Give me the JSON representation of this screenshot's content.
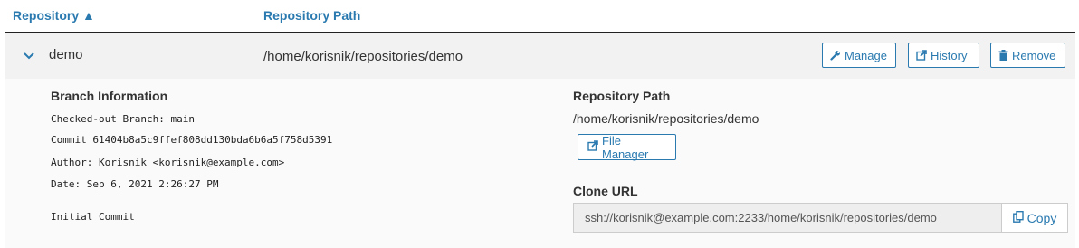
{
  "table": {
    "columns": [
      {
        "label": "Repository ▲"
      },
      {
        "label": "Repository Path"
      }
    ]
  },
  "row": {
    "name": "demo",
    "path": "/home/korisnik/repositories/demo",
    "buttons": {
      "manage": "Manage",
      "history": "History",
      "remove": "Remove"
    }
  },
  "branch_info": {
    "title": "Branch Information",
    "checked_out_label": "Checked-out Branch:",
    "checked_out_value": "main",
    "commit_label": "Commit",
    "commit_value": "61404b8a5c9ffef808dd130bda6b6a5f758d5391",
    "author_label": "Author:",
    "author_value": "Korisnik <korisnik@example.com>",
    "date_label": "Date:",
    "date_value": "Sep 6, 2021 2:26:27 PM",
    "message": "Initial Commit"
  },
  "repo_path_section": {
    "title": "Repository Path",
    "value": "/home/korisnik/repositories/demo",
    "file_manager_label": "File Manager"
  },
  "clone": {
    "title": "Clone URL",
    "url": "ssh://korisnik@example.com:2233/home/korisnik/repositories/demo",
    "copy_label": "Copy"
  },
  "colors": {
    "accent": "#2a7ab0",
    "row_bg": "#f2f2f2",
    "detail_bg": "#fafafa"
  }
}
